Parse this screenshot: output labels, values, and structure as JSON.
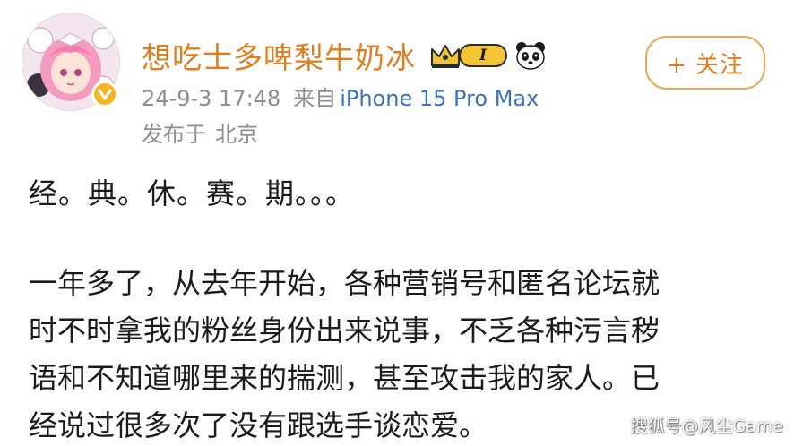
{
  "user": {
    "name": "想吃士多啤梨牛奶冰",
    "level_badge": "I",
    "badges": [
      "crown-icon",
      "level-badge",
      "panda-icon"
    ],
    "verified_icon": "verified-badge-icon",
    "avatar_icon": "anime-avatar"
  },
  "follow_button": {
    "label": "+ 关注"
  },
  "meta": {
    "time": "24-9-3 17:48",
    "from_label": "来自",
    "device": "iPhone 15 Pro Max",
    "location_label": "发布于",
    "location": "北京"
  },
  "post": {
    "paragraph1": "经。典。休。赛。期。。。",
    "paragraph2_lines": [
      "一年多了，从去年开始，各种营销号和匿名论坛就",
      "时不时拿我的粉丝身份出来说事，不乏各种污言秽",
      "语和不知道哪里来的揣测，甚至攻击我的家人。已",
      "经说过很多次了没有跟选手谈恋爱。"
    ]
  },
  "watermark": "搜狐号@风尘Game",
  "colors": {
    "username": "#e07d1f",
    "follow_border": "#e8a857",
    "device_link": "#3d72b8",
    "meta_gray": "#8e8e8e",
    "body_text": "#1b1b1b"
  }
}
